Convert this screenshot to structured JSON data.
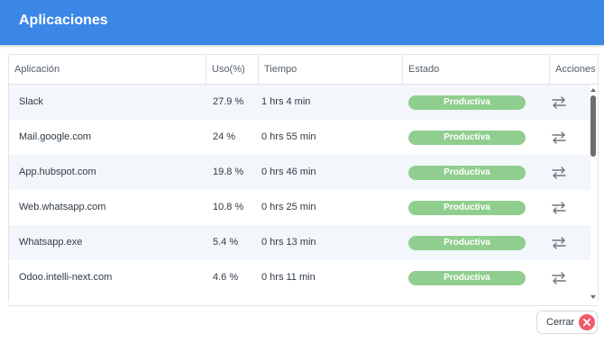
{
  "header": {
    "title": "Aplicaciones"
  },
  "table": {
    "columns": [
      "Aplicación",
      "Uso(%)",
      "Tiempo",
      "Estado",
      "Acciones"
    ],
    "rows": [
      {
        "app": "Slack",
        "usage": "27.9 %",
        "time": "1 hrs 4 min",
        "status": "Productiva"
      },
      {
        "app": "Mail.google.com",
        "usage": "24 %",
        "time": "0 hrs 55 min",
        "status": "Productiva"
      },
      {
        "app": "App.hubspot.com",
        "usage": "19.8 %",
        "time": "0 hrs 46 min",
        "status": "Productiva"
      },
      {
        "app": "Web.whatsapp.com",
        "usage": "10.8 %",
        "time": "0 hrs 25 min",
        "status": "Productiva"
      },
      {
        "app": "Whatsapp.exe",
        "usage": "5.4 %",
        "time": "0 hrs 13 min",
        "status": "Productiva"
      },
      {
        "app": "Odoo.intelli-next.com",
        "usage": "4.6 %",
        "time": "0 hrs 11 min",
        "status": "Productiva"
      }
    ],
    "action_icon": "swap-arrows-icon"
  },
  "footer": {
    "close_label": "Cerrar",
    "close_icon": "close-circle-icon"
  },
  "colors": {
    "header": "#3a87e6",
    "status_productive": "#8fce8f",
    "row_alt": "#f3f7fc",
    "close_icon": "#f05a6a"
  }
}
